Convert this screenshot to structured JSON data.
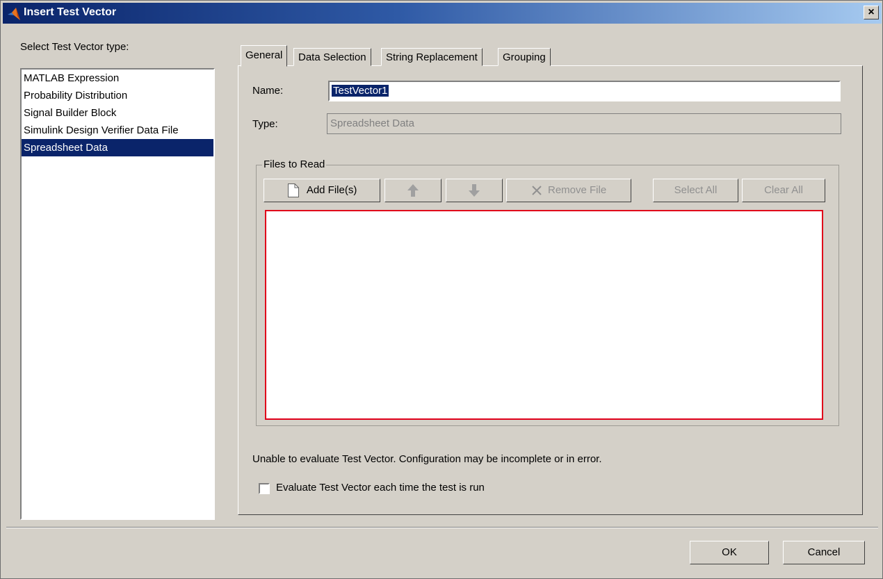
{
  "window": {
    "title": "Insert Test Vector",
    "close_glyph": "×",
    "title_icon": "matlab-logo"
  },
  "left": {
    "label": "Select Test Vector type:",
    "items": [
      {
        "label": "MATLAB Expression",
        "selected": false
      },
      {
        "label": "Probability Distribution",
        "selected": false
      },
      {
        "label": "Signal Builder Block",
        "selected": false
      },
      {
        "label": "Simulink Design Verifier Data File",
        "selected": false
      },
      {
        "label": "Spreadsheet Data",
        "selected": true
      }
    ]
  },
  "tabs": [
    {
      "label": "General",
      "active": true
    },
    {
      "label": "Data Selection",
      "active": false
    },
    {
      "label": "String Replacement",
      "active": false
    },
    {
      "label": "Grouping",
      "active": false
    }
  ],
  "general": {
    "name_label": "Name:",
    "name_value": "TestVector1",
    "type_label": "Type:",
    "type_value": "Spreadsheet Data",
    "files_legend": "Files to Read",
    "buttons": {
      "add_files": "Add File(s)",
      "remove_file": "Remove File",
      "select_all": "Select All",
      "clear_all": "Clear All"
    },
    "error_message": "Unable to evaluate Test Vector. Configuration may be incomplete or in error.",
    "evaluate_checkbox_label": "Evaluate Test Vector each time the test is run",
    "evaluate_checked": false
  },
  "footer": {
    "ok": "OK",
    "cancel": "Cancel"
  },
  "colors": {
    "selection": "#0a246a",
    "error_border": "#e0001a",
    "dialog_bg": "#d4d0c8"
  }
}
